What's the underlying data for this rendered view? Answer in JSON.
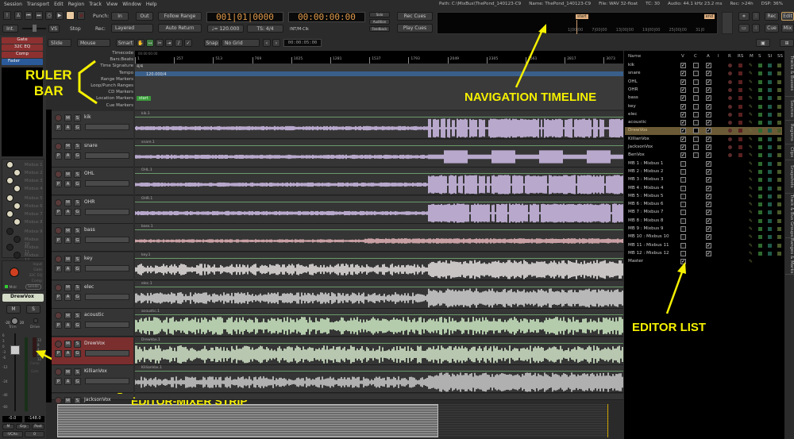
{
  "menu": [
    "Session",
    "Transport",
    "Edit",
    "Region",
    "Track",
    "View",
    "Window",
    "Help"
  ],
  "status": {
    "path": "Path: C:\\MixBus\\ThePond_140123-C9",
    "name": "Name: ThePond_140123-C9",
    "file": "File: WAV 32-float",
    "tc": "TC: 30",
    "audio": "Audio: 44.1 kHz 23.2 ms",
    "rec": "Rec: >24h",
    "dsp": "DSP: 36%"
  },
  "transport": {
    "int": "Int.",
    "vs": "VS",
    "stop": "Stop",
    "punch": "Punch:",
    "in": "In",
    "out": "Out",
    "rec": "Rec:",
    "rec_mode": "Layered",
    "follow_range": "Follow Range",
    "auto_return": "Auto Return",
    "primary_clock": "001|01|0000",
    "secondary_clock": "00:00:00:00",
    "tempo": "♩= 120.000",
    "ts": "TS: 4/4",
    "sync": "INT/M-Clk",
    "solo": "Solo",
    "audition": "Audition",
    "feedback": "Feedback",
    "rec_cues": "Rec Cues",
    "play_cues": "Play Cues"
  },
  "mini_timeline": {
    "start": "start",
    "end": "end",
    "ticks": [
      "1|00|00",
      "7|00|00",
      "13|00|00",
      "19|00|00",
      "25|00|00",
      "31|0"
    ]
  },
  "right_buttons": {
    "num3": "3",
    "num4": "4",
    "rec": "Rec",
    "edit": "Edit",
    "cue": "Cue",
    "mix": "Mix"
  },
  "edit_toolbar": {
    "edit_mode": "Slide",
    "ripple": "Mouse",
    "smart": "Smart",
    "snap": "Snap",
    "grid": "No Grid",
    "nudge_clock": "00:00:05:00"
  },
  "processors": [
    "Gate",
    "32C EQ",
    "Comp",
    "Fader"
  ],
  "rulers": {
    "labels": [
      "Timecode",
      "Bars:Beats",
      "Time Signature",
      "Tempo",
      "Range Markers",
      "Loop/Punch Ranges",
      "CD Markers",
      "Location Markers",
      "Cue Markers"
    ],
    "timecode": "00:00:00:00",
    "bars": [
      "1",
      "257",
      "513",
      "769",
      "1025",
      "1281",
      "1537",
      "1793",
      "2049",
      "2305",
      "2561",
      "2817",
      "3073"
    ],
    "time_sig": "4/4",
    "tempo": "120.000/4",
    "location_marker": "start"
  },
  "mixbus_sends": [
    "Mixbus 1",
    "Mixbus 2",
    "Mixbus 3",
    "Mixbus 4",
    "Mixbus 5",
    "Mixbus 6",
    "Mixbus 7",
    "Mixbus 8",
    "Mixbus 9",
    "Mixbus 10",
    "Mixbus 11",
    "Mixbus 12"
  ],
  "strip": {
    "input": "Input",
    "gate": "Gate",
    "eq": "32C EQ",
    "comp": "Comp",
    "mstr": "Mstr",
    "sends": "Sends",
    "name": "DrewVox",
    "m": "M",
    "s": "S",
    "trim": "Trim",
    "trim_min": "-20",
    "trim_max": "20",
    "drive": "Drive",
    "scale": [
      "6",
      "3",
      "0",
      "-3",
      "-6",
      "-12",
      "-24",
      "-40",
      "-60"
    ],
    "meter_scale": [
      "12",
      "8",
      "4",
      "8",
      "12"
    ],
    "comp_label": "Comp",
    "gate_label": "Gate",
    "gain": "-0.0",
    "peak": "-148.0",
    "grp": "Grp",
    "post": "Post",
    "vca": "-VCAs-",
    "extra": "0"
  },
  "tracks": [
    {
      "name": "kik",
      "region": "kik.1",
      "color": "#b8a8cc",
      "sel": false
    },
    {
      "name": "snare",
      "region": "snare.1",
      "color": "#b8a8cc",
      "sel": false
    },
    {
      "name": "OHL",
      "region": "OHL.1",
      "color": "#b8a8cc",
      "sel": false
    },
    {
      "name": "OHR",
      "region": "OHR.1",
      "color": "#b8a8cc",
      "sel": false
    },
    {
      "name": "bass",
      "region": "bass.1",
      "color": "#c9a0a4",
      "sel": false
    },
    {
      "name": "key",
      "region": "key.1",
      "color": "#c8c4c4",
      "sel": false
    },
    {
      "name": "elec",
      "region": "elec.1",
      "color": "#b8b8b8",
      "sel": false
    },
    {
      "name": "acoustic",
      "region": "acoustic.1",
      "color": "#b4ccac",
      "sel": false
    },
    {
      "name": "DrewVox",
      "region": "DrewVox.1",
      "color": "#b8c8b0",
      "sel": true
    },
    {
      "name": "KillianVox",
      "region": "KillianVox.1",
      "color": "#b0b0b0",
      "sel": false
    },
    {
      "name": "JacksonVox",
      "region": "",
      "color": "#b0b0b0",
      "sel": false
    }
  ],
  "track_buttons": {
    "m": "M",
    "s": "S",
    "p": "P",
    "a": "A",
    "g": "G"
  },
  "editor_list": {
    "headers": [
      "Name",
      "V",
      "C",
      "A",
      "I",
      "R",
      "RS",
      "M",
      "S",
      "SI",
      "SS"
    ],
    "rows": [
      {
        "name": "kik",
        "v": true,
        "c": false,
        "a": true,
        "track": true
      },
      {
        "name": "snare",
        "v": true,
        "c": false,
        "a": true,
        "track": true
      },
      {
        "name": "OHL",
        "v": true,
        "c": false,
        "a": true,
        "track": true
      },
      {
        "name": "OHR",
        "v": true,
        "c": false,
        "a": true,
        "track": true
      },
      {
        "name": "bass",
        "v": true,
        "c": false,
        "a": true,
        "track": true
      },
      {
        "name": "key",
        "v": true,
        "c": false,
        "a": true,
        "track": true
      },
      {
        "name": "elec",
        "v": true,
        "c": false,
        "a": true,
        "track": true
      },
      {
        "name": "acoustic",
        "v": true,
        "c": false,
        "a": true,
        "track": true
      },
      {
        "name": "DrewVox",
        "v": true,
        "c": true,
        "a": true,
        "track": true,
        "sel": true
      },
      {
        "name": "KillianVox",
        "v": true,
        "c": false,
        "a": true,
        "track": true
      },
      {
        "name": "JacksonVox",
        "v": true,
        "c": false,
        "a": true,
        "track": true
      },
      {
        "name": "BenVox",
        "v": true,
        "c": false,
        "a": true,
        "track": true
      },
      {
        "name": "MB 1 : Mixbus 1",
        "v": false,
        "a": true
      },
      {
        "name": "MB 2 : Mixbus 2",
        "v": false,
        "a": true
      },
      {
        "name": "MB 3 : Mixbus 3",
        "v": false,
        "a": true
      },
      {
        "name": "MB 4 : Mixbus 4",
        "v": false,
        "a": true
      },
      {
        "name": "MB 5 : Mixbus 5",
        "v": false,
        "a": true
      },
      {
        "name": "MB 6 : Mixbus 6",
        "v": false,
        "a": true
      },
      {
        "name": "MB 7 : Mixbus 7",
        "v": false,
        "a": true
      },
      {
        "name": "MB 8 : Mixbus 8",
        "v": false,
        "a": true
      },
      {
        "name": "MB 9 : Mixbus 9",
        "v": false,
        "a": true
      },
      {
        "name": "MB 10 : Mixbus 10",
        "v": false,
        "a": true
      },
      {
        "name": "MB 11 : Mixbus 11",
        "v": false,
        "a": true
      },
      {
        "name": "MB 12 : Mixbus 12",
        "v": false,
        "a": true
      },
      {
        "name": "Master",
        "v": true,
        "master": true
      }
    ]
  },
  "side_tabs": [
    "Tracks & Busses",
    "Sources",
    "Regions",
    "Clips",
    "Snapshots",
    "Track & Bus Groups",
    "Ranges & Marks"
  ],
  "annotations": {
    "ruler": "RULER\nBAR",
    "nav": "NAVIGATION TIMELINE",
    "list": "EDITOR LIST",
    "strip": "EDITOR-MIXER STRIP"
  },
  "colors": {
    "clock": "#e09a4a",
    "selected_track": "#7a2e2e",
    "annotation": "#f5f000",
    "tempo_bar": "#3a5f8a"
  }
}
